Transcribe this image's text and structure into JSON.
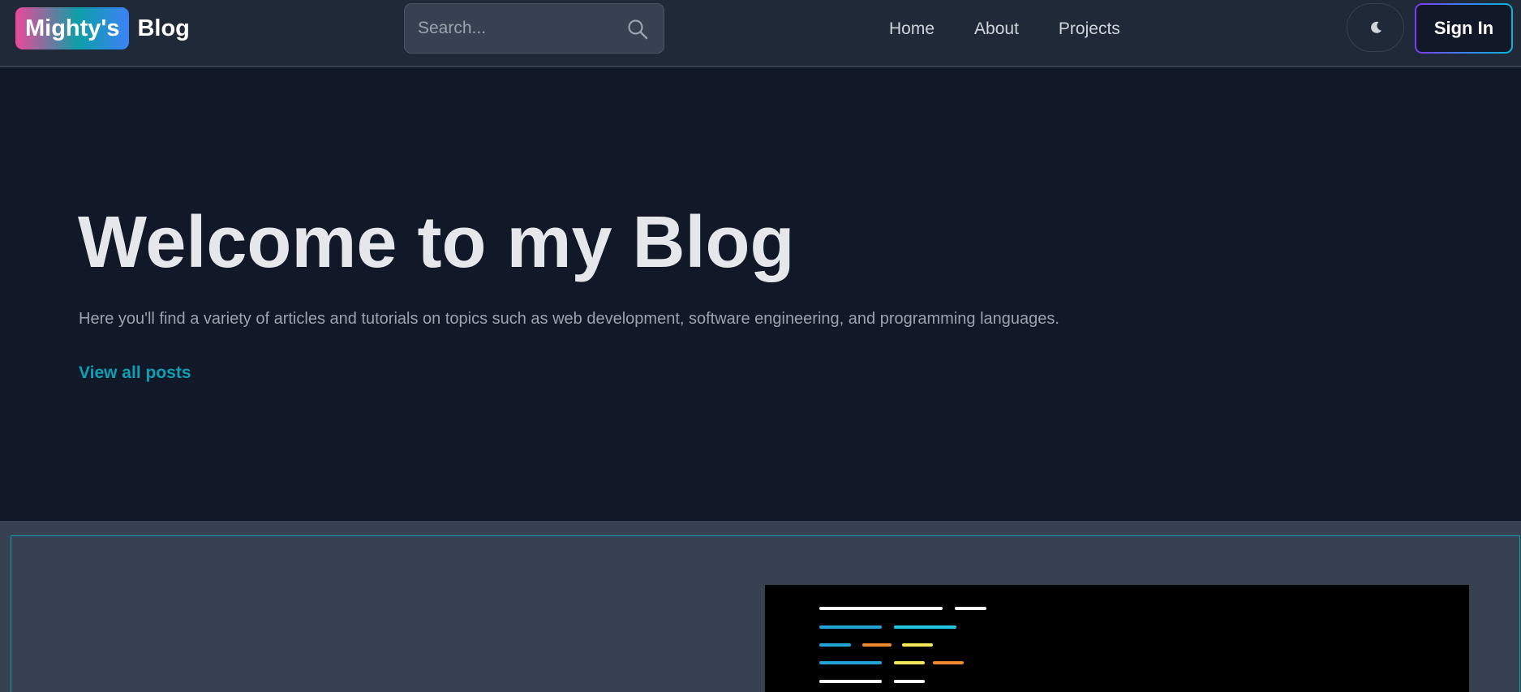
{
  "brand": {
    "highlight": "Mighty's",
    "rest": "Blog"
  },
  "search": {
    "placeholder": "Search..."
  },
  "nav": {
    "links": [
      "Home",
      "About",
      "Projects"
    ]
  },
  "auth": {
    "sign_in_label": "Sign In"
  },
  "theme_toggle": {
    "icon": "moon-icon"
  },
  "hero": {
    "title": "Welcome to my Blog",
    "subtitle": "Here you'll find a variety of articles and tutorials on topics such as web development, software engineering, and programming languages.",
    "cta_label": "View all posts"
  },
  "colors": {
    "page_background": "#111827",
    "navbar_background": "#1f2937",
    "accent_teal": "#0e9fb3",
    "brand_gradient": [
      "#ec4899",
      "#0e9fa7",
      "#3b82f6"
    ],
    "feature_background": "#374151"
  },
  "feature_image": {
    "icon": "code-illustration",
    "code_lines": [
      [
        "#ffffff",
        "#ffffff"
      ],
      [
        "#22a3d6",
        "#22c8e0"
      ],
      [
        "#22a3d6",
        "#f0882d",
        "#f5e75a"
      ],
      [
        "#22a3d6",
        "#f5e75a",
        "#f0882d"
      ],
      [
        "#ffffff",
        "#ffffff"
      ]
    ]
  }
}
